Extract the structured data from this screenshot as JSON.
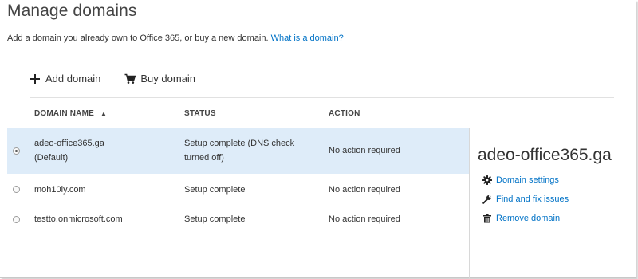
{
  "page": {
    "title": "Manage domains",
    "intro_text": "Add a domain you already own to Office 365, or buy a new domain.",
    "intro_link": "What is a domain?"
  },
  "toolbar": {
    "add_label": "Add domain",
    "buy_label": "Buy domain"
  },
  "table": {
    "headers": {
      "name": "DOMAIN NAME",
      "sort_indicator": "▲",
      "status": "STATUS",
      "action": "ACTION"
    },
    "rows": [
      {
        "name_line1": "adeo-office365.ga",
        "name_line2": "(Default)",
        "status_line1": "Setup complete (DNS check",
        "status_line2": "turned off)",
        "action": "No action required",
        "selected": true
      },
      {
        "name_line1": "moh10ly.com",
        "status_line1": "Setup complete",
        "action": "No action required",
        "selected": false
      },
      {
        "name_line1": "testto.onmicrosoft.com",
        "status_line1": "Setup complete",
        "action": "No action required",
        "selected": false
      }
    ]
  },
  "details_panel": {
    "title": "adeo-office365.ga",
    "links": {
      "settings": "Domain settings",
      "fix": "Find and fix issues",
      "remove": "Remove domain"
    }
  },
  "colors": {
    "link": "#0072c6",
    "selected_row": "#deecf9"
  },
  "icons": {
    "add": "plus-icon",
    "buy": "cart-icon",
    "settings": "gear-icon",
    "fix": "wrench-icon",
    "remove": "trash-icon"
  }
}
